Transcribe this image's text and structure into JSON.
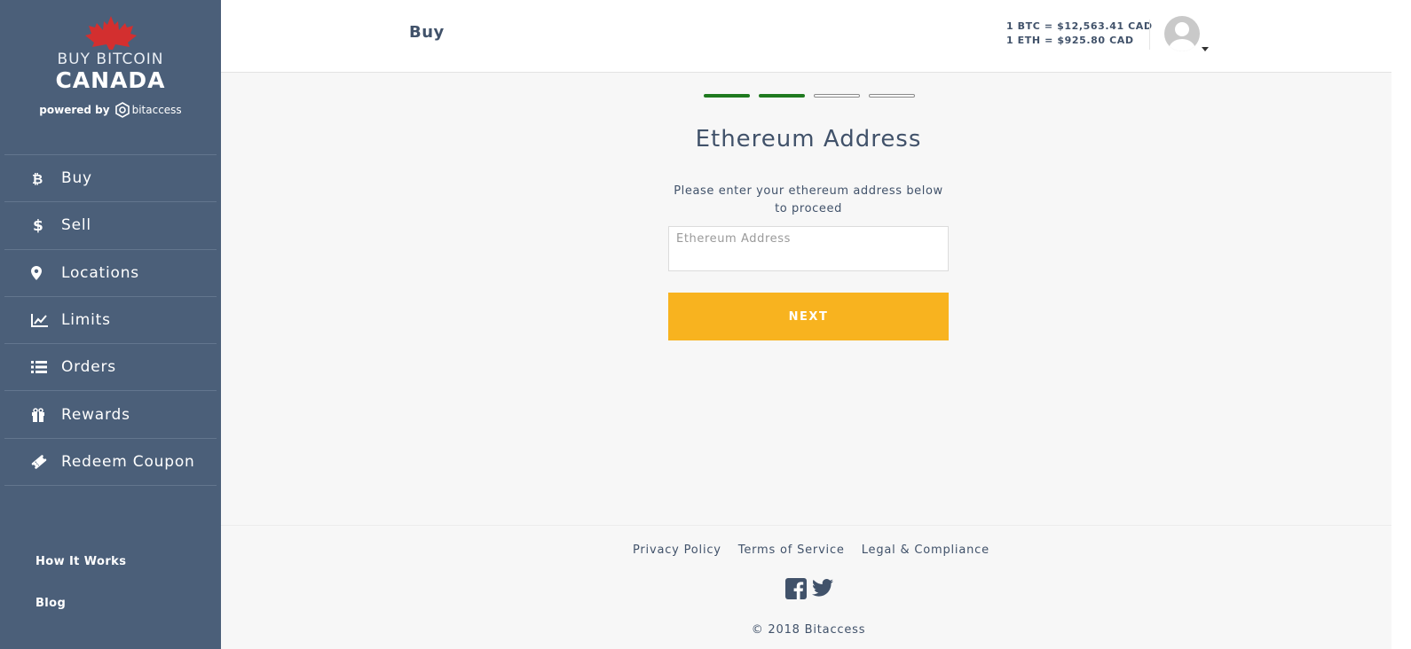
{
  "brand": {
    "line1": "BUY BITCOIN",
    "line2": "CANADA",
    "powered_prefix": "powered by",
    "powered_brand": "bitaccess"
  },
  "sidebar": {
    "items": [
      {
        "label": "Buy",
        "icon": "bitcoin-icon"
      },
      {
        "label": "Sell",
        "icon": "dollar-icon"
      },
      {
        "label": "Locations",
        "icon": "map-pin-icon"
      },
      {
        "label": "Limits",
        "icon": "chart-line-icon"
      },
      {
        "label": "Orders",
        "icon": "list-icon"
      },
      {
        "label": "Rewards",
        "icon": "gift-icon"
      },
      {
        "label": "Redeem Coupon",
        "icon": "ticket-icon"
      }
    ],
    "sub_links": [
      "How It Works",
      "Blog"
    ]
  },
  "header": {
    "title": "Buy",
    "rate_btc": "1 BTC = $12,563.41 CAD",
    "rate_eth": "1 ETH = $925.80 CAD"
  },
  "progress": {
    "total_steps": 4,
    "completed_steps": 2
  },
  "main": {
    "title": "Ethereum Address",
    "instruction": "Please enter your ethereum address below to proceed",
    "address_placeholder": "Ethereum Address",
    "address_value": "",
    "next_label": "NEXT"
  },
  "footer": {
    "links": [
      "Privacy Policy",
      "Terms of Service",
      "Legal & Compliance"
    ],
    "copyright": "© 2018 Bitaccess"
  },
  "colors": {
    "sidebar_bg": "#4b5f79",
    "accent_button": "#f8b31f",
    "step_done": "#1f7a1f",
    "maple_leaf": "#d32f2f",
    "text_dark": "#41526a"
  }
}
